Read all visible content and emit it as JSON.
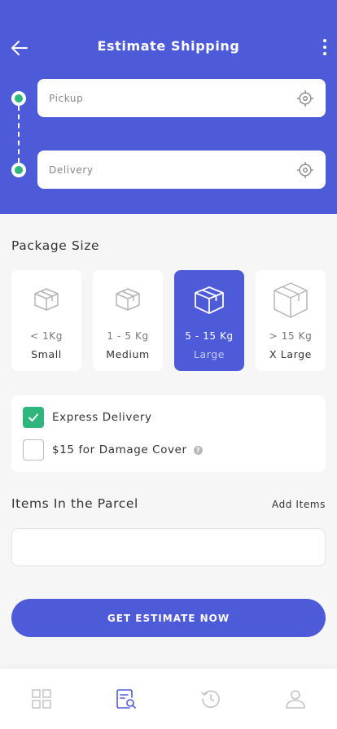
{
  "header": {
    "title": "Estimate Shipping",
    "back_icon": "arrow-left-icon",
    "menu_icon": "more-vertical-icon",
    "bg_color": "#4e5bd9"
  },
  "locations": {
    "pickup_placeholder": "Pickup",
    "delivery_placeholder": "Delivery",
    "locate_icon": "crosshair-icon",
    "dot_color": "#2eb67d"
  },
  "package": {
    "title": "Package Size",
    "selected_index": 2,
    "options": [
      {
        "weight": "< 1Kg",
        "label": "Small"
      },
      {
        "weight": "1 - 5 Kg",
        "label": "Medium"
      },
      {
        "weight": "5 - 15 Kg",
        "label": "Large"
      },
      {
        "weight": "> 15 Kg",
        "label": "X Large"
      }
    ]
  },
  "options": {
    "express": {
      "label": "Express Delivery",
      "checked": true
    },
    "damage": {
      "label": "$15 for Damage Cover",
      "checked": false,
      "help": "?"
    }
  },
  "items": {
    "title": "Items In the Parcel",
    "add_label": "Add Items"
  },
  "cta": {
    "label": "GET ESTIMATE NOW"
  },
  "nav": {
    "items": [
      {
        "icon": "grid-icon",
        "active": false
      },
      {
        "icon": "search-document-icon",
        "active": true
      },
      {
        "icon": "history-icon",
        "active": false
      },
      {
        "icon": "user-icon",
        "active": false
      }
    ],
    "active_color": "#4e5bd9",
    "inactive_color": "#c4c4c4"
  }
}
